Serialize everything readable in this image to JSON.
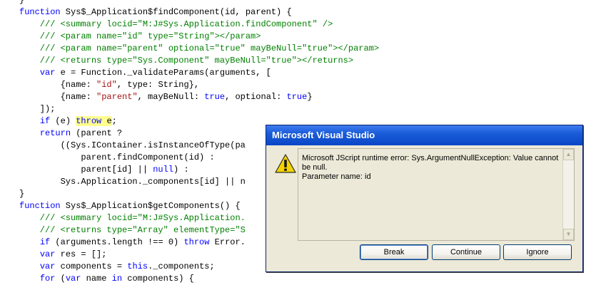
{
  "code_lines": [
    [
      {
        "t": "}",
        "c": "txt"
      }
    ],
    [
      {
        "t": "function",
        "c": "kw"
      },
      {
        "t": " Sys$_Application$findComponent(id, parent) {",
        "c": "txt"
      }
    ],
    [
      {
        "t": "    /// <summary locid=\"M:J#Sys.Application.findComponent\" />",
        "c": "cmt"
      }
    ],
    [
      {
        "t": "    /// <param name=\"id\" type=\"String\"></param>",
        "c": "cmt"
      }
    ],
    [
      {
        "t": "    /// <param name=\"parent\" optional=\"true\" mayBeNull=\"true\"></param>",
        "c": "cmt"
      }
    ],
    [
      {
        "t": "    /// <returns type=\"Sys.Component\" mayBeNull=\"true\"></returns>",
        "c": "cmt"
      }
    ],
    [
      {
        "t": "    ",
        "c": "txt"
      },
      {
        "t": "var",
        "c": "kw"
      },
      {
        "t": " e = Function._validateParams(arguments, [",
        "c": "txt"
      }
    ],
    [
      {
        "t": "        {name: ",
        "c": "txt"
      },
      {
        "t": "\"id\"",
        "c": "str"
      },
      {
        "t": ", type: String},",
        "c": "txt"
      }
    ],
    [
      {
        "t": "        {name: ",
        "c": "txt"
      },
      {
        "t": "\"parent\"",
        "c": "str"
      },
      {
        "t": ", mayBeNull: ",
        "c": "txt"
      },
      {
        "t": "true",
        "c": "kw"
      },
      {
        "t": ", optional: ",
        "c": "txt"
      },
      {
        "t": "true",
        "c": "kw"
      },
      {
        "t": "}",
        "c": "txt"
      }
    ],
    [
      {
        "t": "    ]);",
        "c": "txt"
      }
    ],
    [
      {
        "t": "    ",
        "c": "txt"
      },
      {
        "t": "if",
        "c": "kw"
      },
      {
        "t": " (e) ",
        "c": "txt"
      },
      {
        "t": "throw",
        "c": "kw",
        "h": true
      },
      {
        "t": " e",
        "c": "txt",
        "h": true
      },
      {
        "t": ";",
        "c": "txt"
      }
    ],
    [
      {
        "t": "    ",
        "c": "txt"
      },
      {
        "t": "return",
        "c": "kw"
      },
      {
        "t": " (parent ?",
        "c": "txt"
      }
    ],
    [
      {
        "t": "        ((Sys.IContainer.isInstanceOfType(pa",
        "c": "txt"
      }
    ],
    [
      {
        "t": "            parent.findComponent(id) :",
        "c": "txt"
      }
    ],
    [
      {
        "t": "            parent[id] || ",
        "c": "txt"
      },
      {
        "t": "null",
        "c": "kw"
      },
      {
        "t": ") :",
        "c": "txt"
      }
    ],
    [
      {
        "t": "        Sys.Application._components[id] || n",
        "c": "txt"
      }
    ],
    [
      {
        "t": "}",
        "c": "txt"
      }
    ],
    [
      {
        "t": "function",
        "c": "kw"
      },
      {
        "t": " Sys$_Application$getComponents() {",
        "c": "txt"
      }
    ],
    [
      {
        "t": "    /// <summary locid=\"M:J#Sys.Application.",
        "c": "cmt"
      }
    ],
    [
      {
        "t": "    /// <returns type=\"Array\" elementType=\"S",
        "c": "cmt"
      }
    ],
    [
      {
        "t": "    ",
        "c": "txt"
      },
      {
        "t": "if",
        "c": "kw"
      },
      {
        "t": " (arguments.length !== 0) ",
        "c": "txt"
      },
      {
        "t": "throw",
        "c": "kw"
      },
      {
        "t": " Error.",
        "c": "txt"
      }
    ],
    [
      {
        "t": "    ",
        "c": "txt"
      },
      {
        "t": "var",
        "c": "kw"
      },
      {
        "t": " res = [];",
        "c": "txt"
      }
    ],
    [
      {
        "t": "    ",
        "c": "txt"
      },
      {
        "t": "var",
        "c": "kw"
      },
      {
        "t": " components = ",
        "c": "txt"
      },
      {
        "t": "this",
        "c": "kw"
      },
      {
        "t": "._components;",
        "c": "txt"
      }
    ],
    [
      {
        "t": "    ",
        "c": "txt"
      },
      {
        "t": "for",
        "c": "kw"
      },
      {
        "t": " (",
        "c": "txt"
      },
      {
        "t": "var",
        "c": "kw"
      },
      {
        "t": " name ",
        "c": "txt"
      },
      {
        "t": "in",
        "c": "kw"
      },
      {
        "t": " components) {",
        "c": "txt"
      }
    ]
  ],
  "colors": {
    "keyword": "#0000ff",
    "string": "#a31515",
    "comment": "#008000",
    "text": "#000000",
    "highlight": "#ffff90",
    "dialog_title": "#0a46c7",
    "dialog_body": "#ece9d8"
  },
  "dialog": {
    "title": "Microsoft Visual Studio",
    "icon": "warning-icon",
    "message_lines": [
      "Microsoft JScript runtime error: Sys.ArgumentNullException: Value cannot be null.",
      "Parameter name: id"
    ],
    "buttons": {
      "break": "Break",
      "continue": "Continue",
      "ignore": "Ignore"
    },
    "scroll_up_glyph": "▲",
    "scroll_down_glyph": "▼"
  }
}
